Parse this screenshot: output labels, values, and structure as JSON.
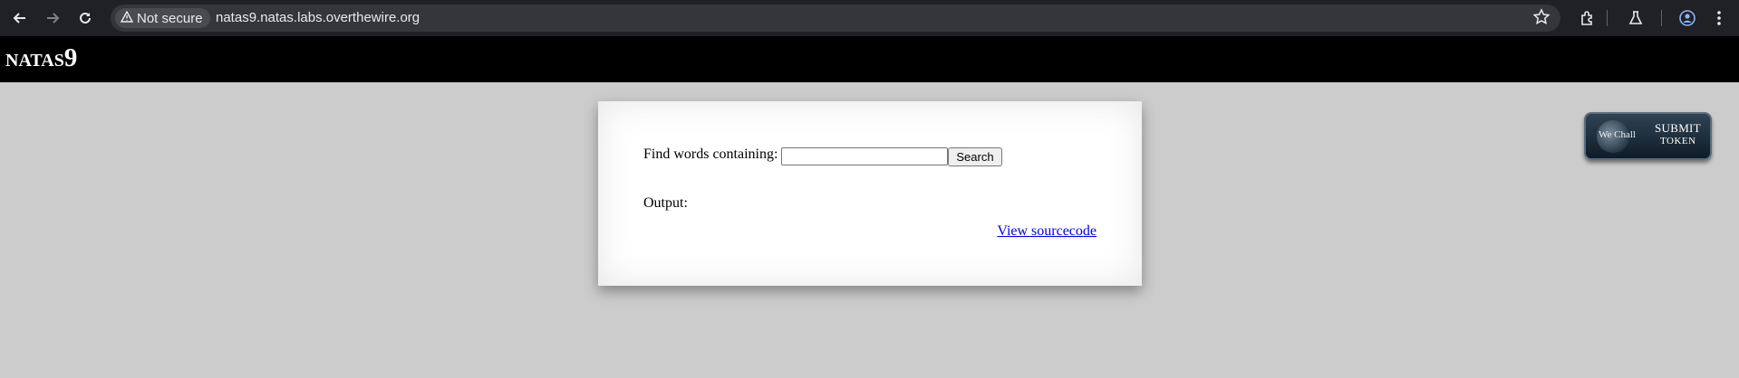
{
  "browser": {
    "security_label": "Not secure",
    "url": "natas9.natas.labs.overthewire.org",
    "icons": [
      "back-icon",
      "forward-icon",
      "reload-icon",
      "warning-icon",
      "star-icon",
      "extensions-icon",
      "labs-icon",
      "profile-icon",
      "menu-icon"
    ]
  },
  "header": {
    "title_prefix": "NATAS",
    "title_number": "9"
  },
  "form": {
    "find_label": "Find words containing:",
    "needle_value": "",
    "search_label": "Search",
    "output_label": "Output:",
    "source_link": "View sourcecode"
  },
  "wechall": {
    "logo_text": "We Chall",
    "line1": "SUBMIT",
    "line2": "TOKEN"
  },
  "colors": {
    "page_bg": "#cccccc",
    "header_bg": "#000000",
    "link": "#0000ee",
    "chrome_bg": "#202124"
  }
}
